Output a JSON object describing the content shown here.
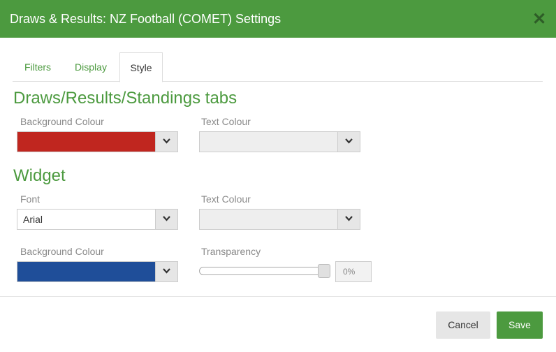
{
  "dialog": {
    "title": "Draws & Results: NZ Football (COMET) Settings",
    "close_icon": "close-icon"
  },
  "tabs": [
    {
      "label": "Filters",
      "active": false
    },
    {
      "label": "Display",
      "active": false
    },
    {
      "label": "Style",
      "active": true
    }
  ],
  "tabs_section": {
    "heading": "Draws/Results/Standings tabs",
    "background_colour": {
      "label": "Background Colour",
      "value": "#c0261f"
    },
    "text_colour": {
      "label": "Text Colour",
      "value": ""
    }
  },
  "widget_section": {
    "heading": "Widget",
    "font": {
      "label": "Font",
      "value": "Arial"
    },
    "text_colour": {
      "label": "Text Colour",
      "value": ""
    },
    "background_colour": {
      "label": "Background Colour",
      "value": "#1f4e99"
    },
    "transparency": {
      "label": "Transparency",
      "value_text": "0%",
      "level": 0
    }
  },
  "footer": {
    "cancel_label": "Cancel",
    "save_label": "Save"
  },
  "colors": {
    "accent": "#4c9a3f",
    "tab_bg_swatch": "#c0261f",
    "widget_bg_swatch": "#1f4e99"
  },
  "icons": {
    "dropdown": "chevron-down-icon",
    "close": "close-icon"
  }
}
